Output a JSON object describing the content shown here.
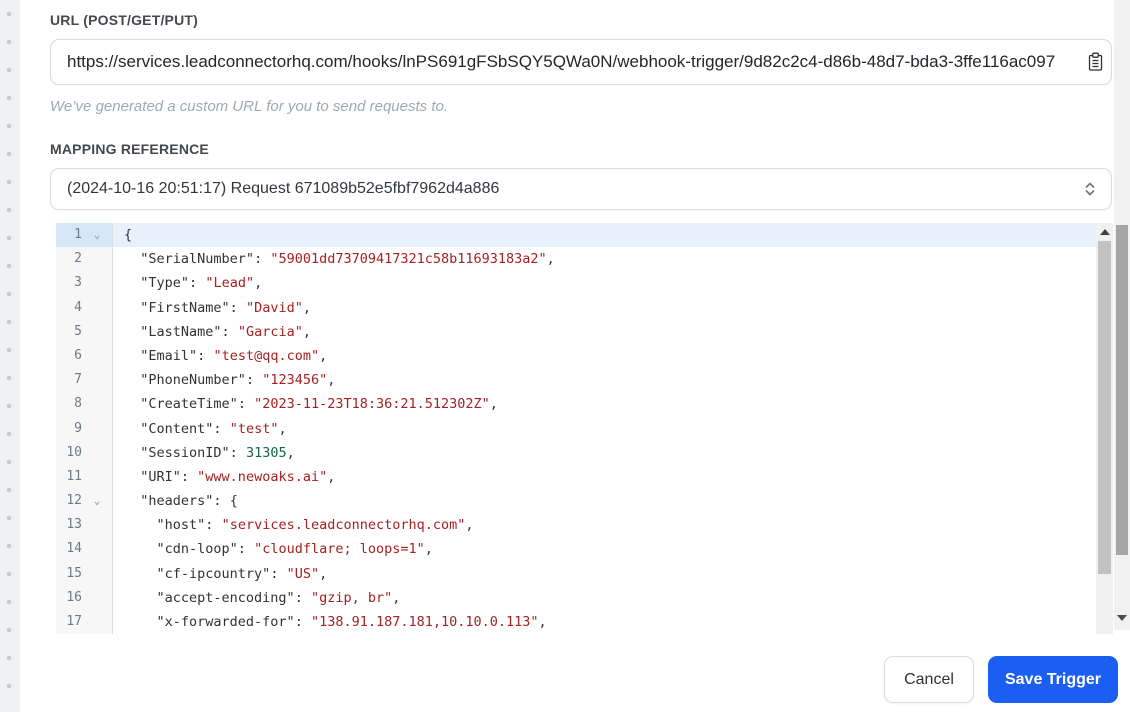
{
  "colors": {
    "accent_blue": "#1a5ff2",
    "json_key": "#333333",
    "json_string": "#a62121",
    "json_number": "#116644",
    "line_number_color": "#6c7a89"
  },
  "url_section": {
    "label": "URL (POST/GET/PUT)",
    "value": "https://services.leadconnectorhq.com/hooks/lnPS691gFSbSQY5QWa0N/webhook-trigger/9d82c2c4-d86b-48d7-bda3-3ffe116ac097",
    "copy_icon": "clipboard-icon",
    "helper": "We’ve generated a custom URL for you to send requests to."
  },
  "mapping_section": {
    "label": "MAPPING REFERENCE",
    "selected_option": "(2024-10-16 20:51:17) Request 671089b52e5fbf7962d4a886",
    "chevron_icon": "up-down-chevron-icon"
  },
  "editor": {
    "language": "json",
    "active_line": 1,
    "lines": [
      {
        "num": 1,
        "fold": true,
        "tokens": [
          [
            "b",
            "{"
          ]
        ]
      },
      {
        "num": 2,
        "fold": false,
        "tokens": [
          [
            "w",
            "  "
          ],
          [
            "k",
            "\"SerialNumber\""
          ],
          [
            "p",
            ": "
          ],
          [
            "s",
            "\"59001dd73709417321c58b11693183a2\""
          ],
          [
            "p",
            ","
          ]
        ]
      },
      {
        "num": 3,
        "fold": false,
        "tokens": [
          [
            "w",
            "  "
          ],
          [
            "k",
            "\"Type\""
          ],
          [
            "p",
            ": "
          ],
          [
            "s",
            "\"Lead\""
          ],
          [
            "p",
            ","
          ]
        ]
      },
      {
        "num": 4,
        "fold": false,
        "tokens": [
          [
            "w",
            "  "
          ],
          [
            "k",
            "\"FirstName\""
          ],
          [
            "p",
            ": "
          ],
          [
            "s",
            "\"David\""
          ],
          [
            "p",
            ","
          ]
        ]
      },
      {
        "num": 5,
        "fold": false,
        "tokens": [
          [
            "w",
            "  "
          ],
          [
            "k",
            "\"LastName\""
          ],
          [
            "p",
            ": "
          ],
          [
            "s",
            "\"Garcia\""
          ],
          [
            "p",
            ","
          ]
        ]
      },
      {
        "num": 6,
        "fold": false,
        "tokens": [
          [
            "w",
            "  "
          ],
          [
            "k",
            "\"Email\""
          ],
          [
            "p",
            ": "
          ],
          [
            "s",
            "\"test@qq.com\""
          ],
          [
            "p",
            ","
          ]
        ]
      },
      {
        "num": 7,
        "fold": false,
        "tokens": [
          [
            "w",
            "  "
          ],
          [
            "k",
            "\"PhoneNumber\""
          ],
          [
            "p",
            ": "
          ],
          [
            "s",
            "\"123456\""
          ],
          [
            "p",
            ","
          ]
        ]
      },
      {
        "num": 8,
        "fold": false,
        "tokens": [
          [
            "w",
            "  "
          ],
          [
            "k",
            "\"CreateTime\""
          ],
          [
            "p",
            ": "
          ],
          [
            "s",
            "\"2023-11-23T18:36:21.512302Z\""
          ],
          [
            "p",
            ","
          ]
        ]
      },
      {
        "num": 9,
        "fold": false,
        "tokens": [
          [
            "w",
            "  "
          ],
          [
            "k",
            "\"Content\""
          ],
          [
            "p",
            ": "
          ],
          [
            "s",
            "\"test\""
          ],
          [
            "p",
            ","
          ]
        ]
      },
      {
        "num": 10,
        "fold": false,
        "tokens": [
          [
            "w",
            "  "
          ],
          [
            "k",
            "\"SessionID\""
          ],
          [
            "p",
            ": "
          ],
          [
            "n",
            "31305"
          ],
          [
            "p",
            ","
          ]
        ]
      },
      {
        "num": 11,
        "fold": false,
        "tokens": [
          [
            "w",
            "  "
          ],
          [
            "k",
            "\"URI\""
          ],
          [
            "p",
            ": "
          ],
          [
            "s",
            "\"www.newoaks.ai\""
          ],
          [
            "p",
            ","
          ]
        ]
      },
      {
        "num": 12,
        "fold": true,
        "tokens": [
          [
            "w",
            "  "
          ],
          [
            "k",
            "\"headers\""
          ],
          [
            "p",
            ": "
          ],
          [
            "b",
            "{"
          ]
        ]
      },
      {
        "num": 13,
        "fold": false,
        "tokens": [
          [
            "w",
            "    "
          ],
          [
            "k",
            "\"host\""
          ],
          [
            "p",
            ": "
          ],
          [
            "s",
            "\"services.leadconnectorhq.com\""
          ],
          [
            "p",
            ","
          ]
        ]
      },
      {
        "num": 14,
        "fold": false,
        "tokens": [
          [
            "w",
            "    "
          ],
          [
            "k",
            "\"cdn-loop\""
          ],
          [
            "p",
            ": "
          ],
          [
            "s",
            "\"cloudflare; loops=1\""
          ],
          [
            "p",
            ","
          ]
        ]
      },
      {
        "num": 15,
        "fold": false,
        "tokens": [
          [
            "w",
            "    "
          ],
          [
            "k",
            "\"cf-ipcountry\""
          ],
          [
            "p",
            ": "
          ],
          [
            "s",
            "\"US\""
          ],
          [
            "p",
            ","
          ]
        ]
      },
      {
        "num": 16,
        "fold": false,
        "tokens": [
          [
            "w",
            "    "
          ],
          [
            "k",
            "\"accept-encoding\""
          ],
          [
            "p",
            ": "
          ],
          [
            "s",
            "\"gzip, br\""
          ],
          [
            "p",
            ","
          ]
        ]
      },
      {
        "num": 17,
        "fold": false,
        "tokens": [
          [
            "w",
            "    "
          ],
          [
            "k",
            "\"x-forwarded-for\""
          ],
          [
            "p",
            ": "
          ],
          [
            "s",
            "\"138.91.187.181,10.10.0.113\""
          ],
          [
            "p",
            ","
          ]
        ]
      }
    ]
  },
  "footer": {
    "cancel_label": "Cancel",
    "save_label": "Save Trigger"
  }
}
